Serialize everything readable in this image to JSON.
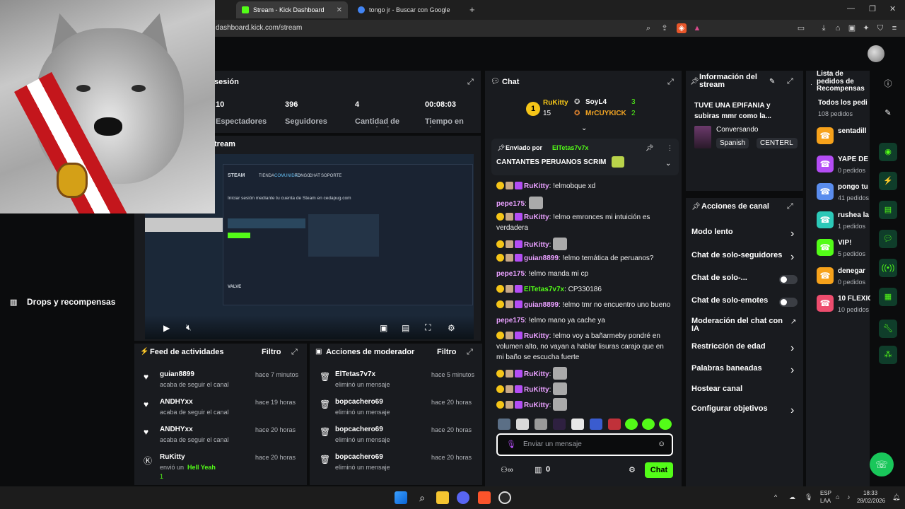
{
  "browser": {
    "tabs": [
      {
        "label": "Stream - Kick Dashboard",
        "active": true
      },
      {
        "label": "tongo jr - Buscar con Google",
        "active": false
      }
    ],
    "url": "dashboard.kick.com/stream"
  },
  "sidebar": {
    "drops_label": "Drops y recompensas"
  },
  "session": {
    "title": "sesión",
    "stats": [
      {
        "value": "10",
        "label": "Espectadores"
      },
      {
        "value": "396",
        "label": "Seguidores"
      },
      {
        "value": "4",
        "label": "Cantidad de suscripciones"
      },
      {
        "value": "00:08:03",
        "label": "Tiempo en vivo"
      }
    ]
  },
  "stream_panel": {
    "title": "tream"
  },
  "video_content": {
    "steam_logo": "STEAM",
    "nav": [
      "TIENDA",
      "COMUNIDAD",
      "TONGO",
      "CHAT",
      "SOPORTE"
    ],
    "login_title": "Iniciar sesión mediante tu cuenta de Steam en cedapug.com",
    "footer_brand": "VALVE"
  },
  "activity_feed": {
    "title": "Feed de actividades",
    "filter_label": "Filtro",
    "items": [
      {
        "name": "guian8899",
        "action": "acaba de seguir el canal",
        "time": "hace 7 minutos",
        "icon": "heart-icon"
      },
      {
        "name": "ANDHYxx",
        "action": "acaba de seguir el canal",
        "time": "hace 19 horas",
        "icon": "heart-icon"
      },
      {
        "name": "ANDHYxx",
        "action": "acaba de seguir el canal",
        "time": "hace 20 horas",
        "icon": "heart-icon"
      },
      {
        "name": "RuKitty",
        "action": "envió un",
        "highlight": "Hell Yeah",
        "time": "hace 20 horas",
        "count": "1",
        "icon": "kick-icon"
      }
    ]
  },
  "mod_actions": {
    "title": "Acciones de moderador",
    "filter_label": "Filtro",
    "items": [
      {
        "name": "ElTetas7v7x",
        "action": "eliminó un mensaje",
        "time": "hace 5 minutos"
      },
      {
        "name": "bopcachero69",
        "action": "eliminó un mensaje",
        "time": "hace 20 horas"
      },
      {
        "name": "bopcachero69",
        "action": "eliminó un mensaje",
        "time": "hace 20 horas"
      },
      {
        "name": "bopcachero69",
        "action": "eliminó un mensaje",
        "time": "hace 20 horas"
      }
    ]
  },
  "chat": {
    "title": "Chat",
    "leaderboard": {
      "rank": "1",
      "top": {
        "name": "RuKitty",
        "count": "15"
      },
      "entries": [
        {
          "name": "SoyL4",
          "count": "3"
        },
        {
          "name": "MrCUYKICK",
          "count": "2"
        }
      ]
    },
    "pinned": {
      "label": "Enviado por",
      "user": "ElTetas7v7x",
      "message": "CANTANTES PERUANOS SCRIM"
    },
    "messages": [
      {
        "user": "RuKitty",
        "text": "!elmobque xd",
        "color": "#e9a0ff",
        "badges": true,
        "emote": false
      },
      {
        "user": "pepe175",
        "text": "",
        "color": "#e9a0ff",
        "badges": false,
        "emote": true
      },
      {
        "user": "RuKitty",
        "text": "!elmo emronces mi intuición es verdadera",
        "color": "#e9a0ff",
        "badges": true,
        "emote": false
      },
      {
        "user": "RuKitty",
        "text": "",
        "color": "#e9a0ff",
        "badges": true,
        "emote": true
      },
      {
        "user": "guian8899",
        "text": "!elmo temática de peruanos?",
        "color": "#e9a0ff",
        "badges": true,
        "emote": false
      },
      {
        "user": "pepe175",
        "text": "!elmo manda mi cp",
        "color": "#e9a0ff",
        "badges": false,
        "emote": false
      },
      {
        "user": "ElTetas7v7x",
        "text": "CP330186",
        "color": "#53fc18",
        "badges": true,
        "emote": false
      },
      {
        "user": "guian8899",
        "text": "!elmo tmr no encuentro uno bueno",
        "color": "#e9a0ff",
        "badges": true,
        "emote": false
      },
      {
        "user": "pepe175",
        "text": "!elmo mano ya cache ya",
        "color": "#e9a0ff",
        "badges": false,
        "emote": false
      },
      {
        "user": "RuKitty",
        "text": "!elmo voy a bañarmeby pondré en volumen alto, no vayan a hablar lisuras carajo que en mi baño se escucha fuerte",
        "color": "#e9a0ff",
        "badges": true,
        "emote": false
      },
      {
        "user": "RuKitty",
        "text": "",
        "color": "#e9a0ff",
        "badges": true,
        "emote": true
      },
      {
        "user": "RuKitty",
        "text": "",
        "color": "#e9a0ff",
        "badges": true,
        "emote": true
      },
      {
        "user": "RuKitty",
        "text": "",
        "color": "#e9a0ff",
        "badges": true,
        "emote": true
      }
    ],
    "input_placeholder": "Enviar un mensaje",
    "send_label": "Chat",
    "viewers_count": "0"
  },
  "stream_info": {
    "title": "Información del stream",
    "stream_title": "TUVE UNA EPIFANIA y subiras mmr como la...",
    "category": "Conversando",
    "tags": [
      "Spanish",
      "CENTERL"
    ]
  },
  "channel_actions": {
    "title": "Acciones de canal",
    "items": [
      {
        "label": "Modo lento",
        "control": "chevron"
      },
      {
        "label": "Chat de solo-seguidores",
        "control": "chevron"
      },
      {
        "label": "Chat de solo-...",
        "control": "toggle"
      },
      {
        "label": "Chat de solo-emotes",
        "control": "toggle"
      },
      {
        "label": "Moderación del chat con IA",
        "control": "external"
      },
      {
        "label": "Restricción de edad",
        "control": "chevron"
      },
      {
        "label": "Palabras baneadas",
        "control": "chevron"
      },
      {
        "label": "Hostear canal",
        "control": "none"
      },
      {
        "label": "Configurar objetivos",
        "control": "chevron"
      }
    ]
  },
  "rewards": {
    "title": "Lista de pedidos de Recompensas",
    "all_label": "Todos los pedi",
    "all_count": "108 pedidos",
    "items": [
      {
        "name": "sentadill",
        "count": "",
        "color": "#f7a21b"
      },
      {
        "name": "YAPE DE",
        "count": "0 pedidos",
        "color": "#b44df5"
      },
      {
        "name": "pongo tu",
        "count": "41 pedidos",
        "color": "#5a8dee"
      },
      {
        "name": "rushea la",
        "count": "1 pedidos",
        "color": "#2cc9b8"
      },
      {
        "name": "VIP!",
        "count": "5 pedidos",
        "color": "#53fc18"
      },
      {
        "name": "denegar",
        "count": "0 pedidos",
        "color": "#f7a21b"
      },
      {
        "name": "10 FLEXIO",
        "count": "10 pedidos",
        "color": "#ee4d6e"
      }
    ]
  },
  "taskbar": {
    "lang": "ESP",
    "region": "LAA",
    "time": "18:33",
    "date": "28/02/2026"
  }
}
